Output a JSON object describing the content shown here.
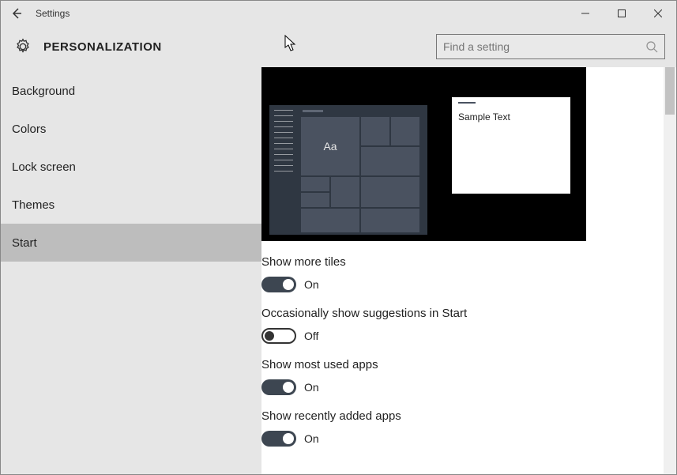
{
  "titlebar": {
    "title": "Settings"
  },
  "header": {
    "title": "PERSONALIZATION"
  },
  "search": {
    "placeholder": "Find a setting"
  },
  "sidebar": {
    "items": [
      {
        "label": "Background"
      },
      {
        "label": "Colors"
      },
      {
        "label": "Lock screen"
      },
      {
        "label": "Themes"
      },
      {
        "label": "Start"
      }
    ],
    "selected_index": 4
  },
  "preview": {
    "tile_letters": "Aa",
    "window_sample": "Sample Text"
  },
  "settings": [
    {
      "label": "Show more tiles",
      "state": "on",
      "state_label": "On"
    },
    {
      "label": "Occasionally show suggestions in Start",
      "state": "off",
      "state_label": "Off"
    },
    {
      "label": "Show most used apps",
      "state": "on",
      "state_label": "On"
    },
    {
      "label": "Show recently added apps",
      "state": "on",
      "state_label": "On"
    }
  ]
}
